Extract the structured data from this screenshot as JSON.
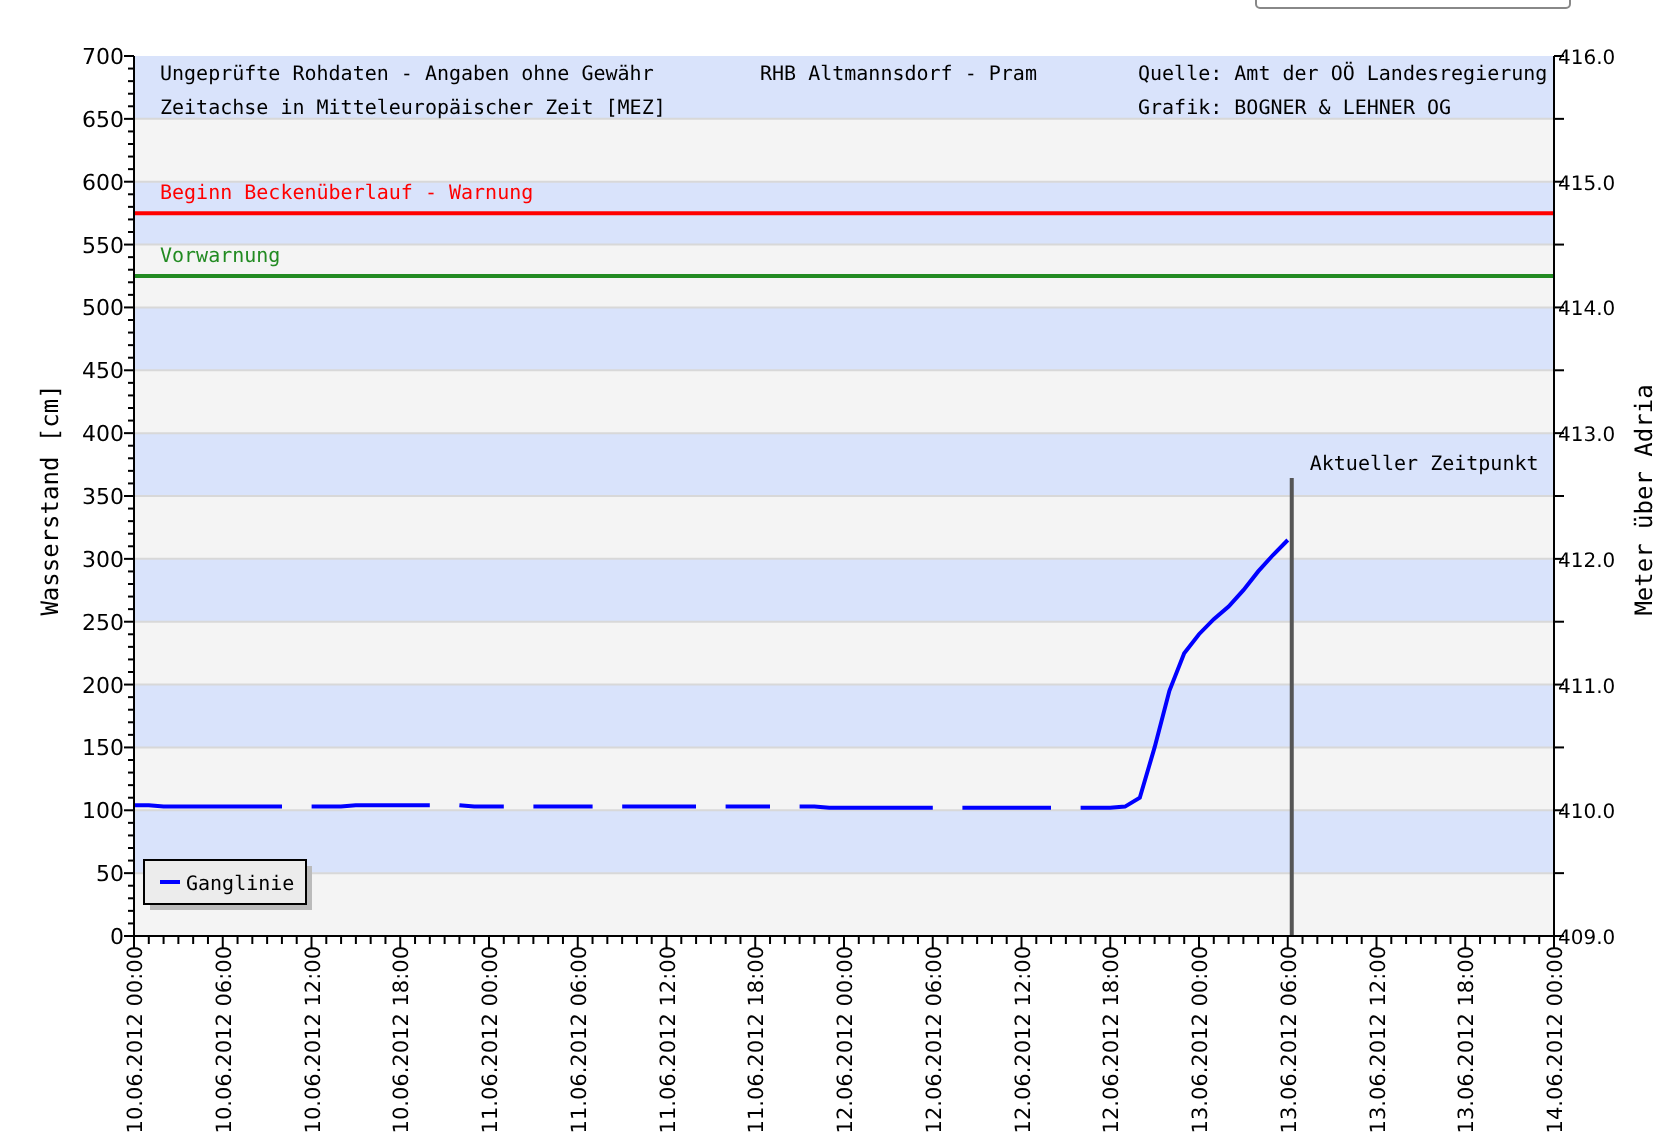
{
  "header": {
    "notes": [
      "Ungeprüfte Rohdaten - Angaben ohne Gewähr",
      "Zeitachse in Mitteleuropäischer Zeit [MEZ]"
    ],
    "station": "RHB Altmannsdorf - Pram",
    "credits": [
      "Quelle: Amt der OÖ Landesregierung",
      "Grafik: BOGNER & LEHNER OG"
    ]
  },
  "chart_data": {
    "type": "line",
    "ylabel": "Wasserstand [cm]",
    "ylim": [
      0,
      700
    ],
    "yticks": [
      0,
      50,
      100,
      150,
      200,
      250,
      300,
      350,
      400,
      450,
      500,
      550,
      600,
      650,
      700
    ],
    "categories": [
      "10.06.2012 00:00",
      null,
      null,
      null,
      null,
      null,
      "10.06.2012 06:00",
      null,
      null,
      null,
      null,
      null,
      "10.06.2012 12:00",
      null,
      null,
      null,
      null,
      null,
      "10.06.2012 18:00",
      null,
      null,
      null,
      null,
      null,
      "11.06.2012 00:00",
      null,
      null,
      null,
      null,
      null,
      "11.06.2012 06:00",
      null,
      null,
      null,
      null,
      null,
      "11.06.2012 12:00",
      null,
      null,
      null,
      null,
      null,
      "11.06.2012 18:00",
      null,
      null,
      null,
      null,
      null,
      "12.06.2012 00:00",
      null,
      null,
      null,
      null,
      null,
      "12.06.2012 06:00",
      null,
      null,
      null,
      null,
      null,
      "12.06.2012 12:00",
      null,
      null,
      null,
      null,
      null,
      "12.06.2012 18:00",
      null,
      null,
      null,
      null,
      null,
      "13.06.2012 00:00",
      null,
      null,
      null,
      null,
      null,
      "13.06.2012 06:00",
      null,
      null,
      null,
      null,
      null,
      "13.06.2012 12:00",
      null,
      null,
      null,
      null,
      null,
      "13.06.2012 18:00",
      null,
      null,
      null,
      null,
      null,
      "14.06.2012 00:00"
    ],
    "series": [
      {
        "name": "Ganglinie",
        "color": "#0000ff",
        "values": [
          104,
          104,
          103,
          103,
          103,
          103,
          103,
          103,
          103,
          103,
          103,
          null,
          103,
          103,
          103,
          104,
          104,
          104,
          104,
          104,
          104,
          null,
          104,
          103,
          103,
          103,
          null,
          103,
          103,
          103,
          103,
          103,
          null,
          103,
          103,
          103,
          103,
          103,
          103,
          null,
          103,
          103,
          103,
          103,
          null,
          103,
          103,
          102,
          102,
          102,
          102,
          102,
          102,
          102,
          102,
          null,
          102,
          102,
          102,
          102,
          102,
          102,
          102,
          null,
          102,
          102,
          102,
          103,
          110,
          150,
          195,
          225,
          240,
          252,
          262,
          275,
          290,
          303,
          315,
          null,
          null,
          null,
          null,
          null,
          null,
          null,
          null,
          null,
          null,
          null,
          null,
          null,
          null,
          null,
          null,
          null,
          null
        ]
      }
    ],
    "ref_lines": [
      {
        "axis": "y",
        "value": 575,
        "label": "Beginn Beckenüberlauf - Warnung",
        "color": "#ff0000"
      },
      {
        "axis": "y",
        "value": 525,
        "label": "Vorwarnung",
        "color": "#228b22"
      }
    ],
    "grid": true
  },
  "current_time": {
    "label": "Aktueller Zeitpunkt"
  },
  "right_axis": {
    "title": "Meter über Adria",
    "labels": [
      "416.0",
      "415.0",
      "414.0",
      "413.0",
      "412.0",
      "411.0",
      "410.0",
      "409.0"
    ]
  }
}
